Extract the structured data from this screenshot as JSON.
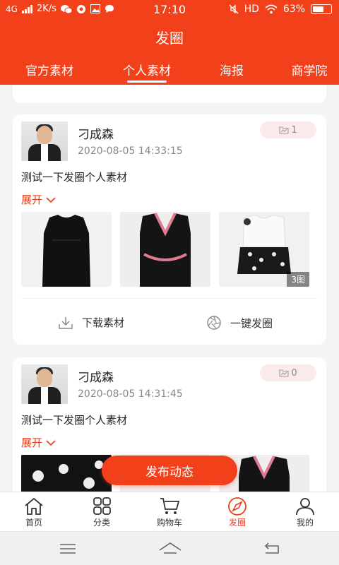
{
  "status_bar": {
    "network": "4G",
    "speed": "2K/s",
    "time": "17:10",
    "hd": "HD",
    "battery": "63%",
    "battery_level": 0.63
  },
  "app": {
    "title": "发圈",
    "accent_color": "#f2401b"
  },
  "tabs": [
    {
      "label": "官方素材",
      "active": false
    },
    {
      "label": "个人素材",
      "active": true
    },
    {
      "label": "海报",
      "active": false
    },
    {
      "label": "商学院",
      "active": false
    }
  ],
  "posts": [
    {
      "author": "刁成森",
      "time": "2020-08-05 14:33:15",
      "share_count": "1",
      "text": "测试一下发圈个人素材",
      "expand_label": "展开",
      "photo_count_label": "3图",
      "download_label": "下载素材",
      "share_label": "一键发圈"
    },
    {
      "author": "刁成森",
      "time": "2020-08-05 14:31:45",
      "share_count": "0",
      "text": "测试一下发圈个人素材",
      "expand_label": "展开"
    }
  ],
  "fab_label": "发布动态",
  "bottom_nav": [
    {
      "label": "首页",
      "icon": "home-icon"
    },
    {
      "label": "分类",
      "icon": "category-icon"
    },
    {
      "label": "购物车",
      "icon": "cart-icon"
    },
    {
      "label": "发圈",
      "icon": "compass-icon",
      "active": true
    },
    {
      "label": "我的",
      "icon": "user-icon"
    }
  ]
}
